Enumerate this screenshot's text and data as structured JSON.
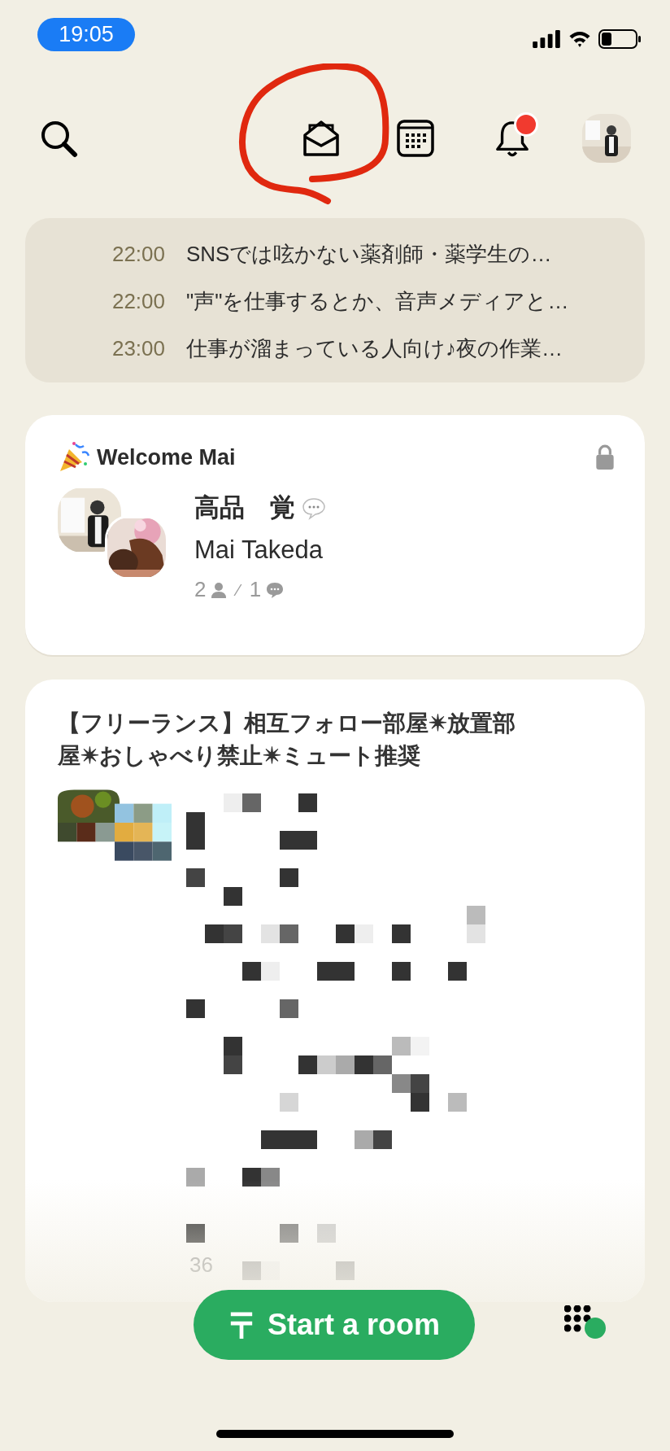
{
  "status_bar": {
    "time": "19:05"
  },
  "toolbar": {
    "notifications_unread": true
  },
  "schedule": [
    {
      "time": "22:00",
      "title": "SNSでは呟かない薬剤師・薬学生の…"
    },
    {
      "time": "22:00",
      "title": "\"声\"を仕事するとか、音声メディアと…"
    },
    {
      "time": "23:00",
      "title": "仕事が溜まっている人向け♪夜の作業…"
    }
  ],
  "rooms": [
    {
      "kind": "club",
      "title": "Welcome Mai",
      "locked": true,
      "speakers": [
        "高品　覚",
        "Mai Takeda"
      ],
      "listeners": "2",
      "separator": "⁄",
      "messages": "1"
    },
    {
      "kind": "redacted",
      "title": "【フリーランス】相互フォロー部屋✴放置部屋✴おしゃべり禁止✴ミュート推奨",
      "count_fragment": "36"
    }
  ],
  "start_button": {
    "label": "Start a room"
  }
}
